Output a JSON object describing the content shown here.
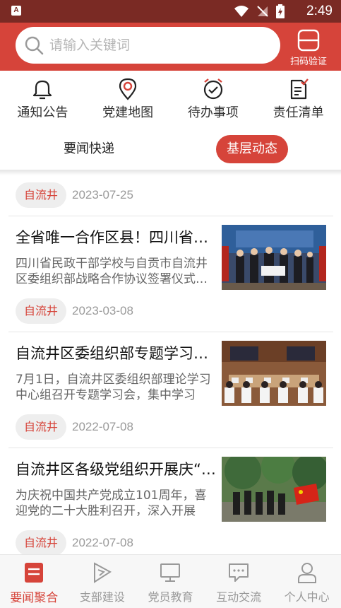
{
  "status_bar": {
    "time": "2:49",
    "app_badge": "A"
  },
  "search": {
    "placeholder": "请输入关键词"
  },
  "scan": {
    "label": "扫码验证",
    "icon": "scan-icon"
  },
  "quick_actions": [
    {
      "label": "通知公告",
      "icon": "bell-icon"
    },
    {
      "label": "党建地图",
      "icon": "map-pin-icon"
    },
    {
      "label": "待办事项",
      "icon": "alarm-clock-icon"
    },
    {
      "label": "责任清单",
      "icon": "checklist-icon"
    }
  ],
  "tabs": [
    {
      "label": "要闻快递",
      "active": false
    },
    {
      "label": "基层动态",
      "active": true
    }
  ],
  "feed": {
    "top_meta": {
      "tag": "自流井",
      "date": "2023-07-25"
    },
    "items": [
      {
        "title": "全省唯一合作区县！四川省民政干部学校与自贡市自流井区委组织部战略合作协议签署",
        "summary": "四川省民政干部学校与自贡市自流井区委组织部战略合作协议签署仪式举行",
        "tag": "自流井",
        "date": "2023-03-08"
      },
      {
        "title": "自流井区委组织部专题学习会召开",
        "summary": "7月1日，自流井区委组织部理论学习中心组召开专题学习会，集中学习",
        "tag": "自流井",
        "date": "2022-07-08"
      },
      {
        "title": "自流井区各级党组织开展庆“七一”系列活动",
        "summary": "为庆祝中国共产党成立101周年，喜迎党的二十大胜利召开，深入开展",
        "tag": "自流井",
        "date": "2022-07-08"
      }
    ]
  },
  "bottom_nav": [
    {
      "label": "要闻聚合",
      "icon": "news-icon",
      "active": true
    },
    {
      "label": "支部建设",
      "icon": "flag-icon",
      "active": false
    },
    {
      "label": "党员教育",
      "icon": "monitor-icon",
      "active": false
    },
    {
      "label": "互动交流",
      "icon": "chat-icon",
      "active": false
    },
    {
      "label": "个人中心",
      "icon": "user-icon",
      "active": false
    }
  ],
  "colors": {
    "primary": "#d6443a",
    "status_bar": "#7a2a24"
  }
}
